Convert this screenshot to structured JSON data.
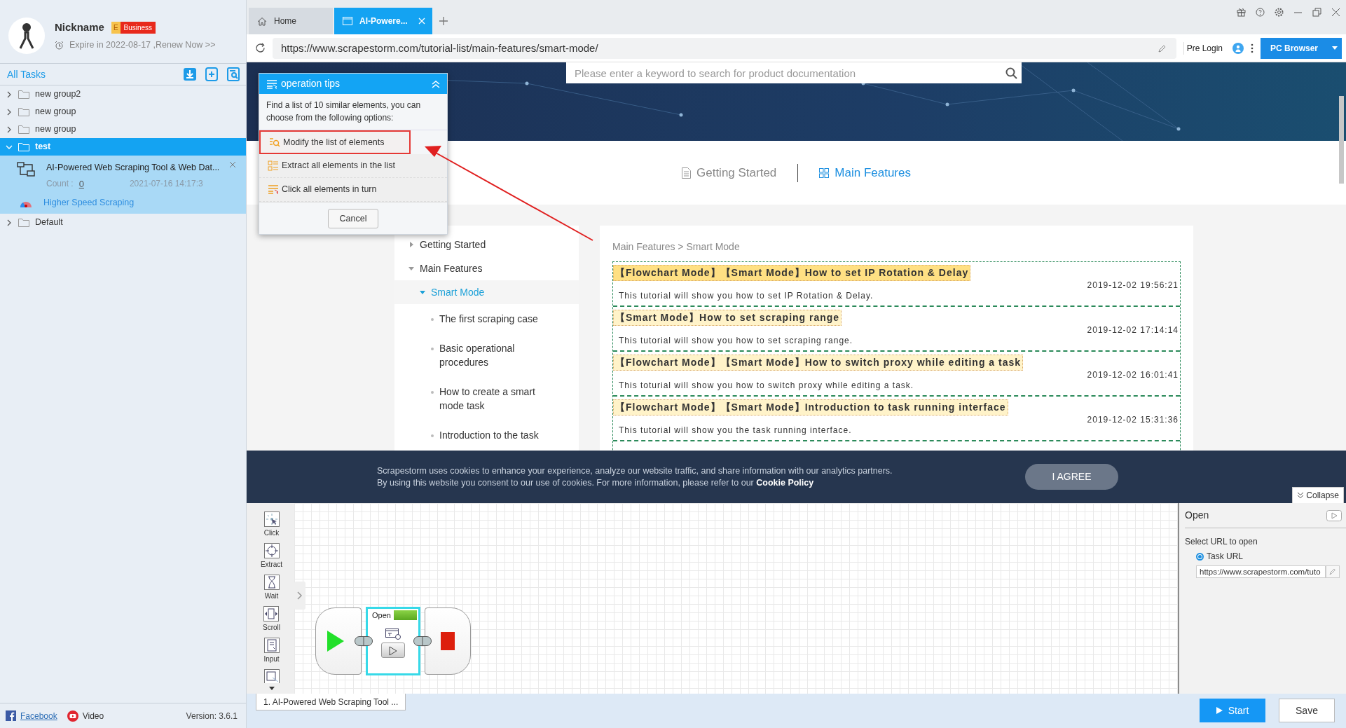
{
  "profile": {
    "nickname": "Nickname",
    "badge_letter": "E",
    "badge": "Business",
    "expire": "Expire in 2022-08-17 ,Renew Now >>"
  },
  "task_header": {
    "title": "All Tasks"
  },
  "groups": [
    {
      "name": "new group2",
      "expanded": false,
      "selected": false
    },
    {
      "name": "new group",
      "expanded": false,
      "selected": false
    },
    {
      "name": "new group",
      "expanded": false,
      "selected": false
    },
    {
      "name": "test",
      "expanded": true,
      "selected": true,
      "tasks": [
        {
          "title": "AI-Powered Web Scraping Tool & Web Dat...",
          "count_label": "Count :",
          "count": "0",
          "time": "2021-07-16 14:17:3",
          "speed": "Higher Speed Scraping"
        }
      ]
    },
    {
      "name": "Default",
      "expanded": false,
      "selected": false
    }
  ],
  "sidebar_footer": {
    "links": [
      "Facebook",
      "Video"
    ],
    "version": "Version: 3.6.1"
  },
  "browser": {
    "tabs": [
      {
        "label": "Home",
        "kind": "home",
        "selected": false,
        "closable": false
      },
      {
        "label": "AI-Powere...",
        "kind": "page",
        "selected": true,
        "closable": true
      }
    ],
    "url": "https://www.scrapestorm.com/tutorial-list/main-features/smart-mode/",
    "pre_login": "Pre Login",
    "mode": "PC Browser"
  },
  "page": {
    "search_placeholder": "Please enter a keyword to search for product documentation",
    "section_tabs": [
      {
        "label": "Getting Started",
        "kind": "doc",
        "selected": false
      },
      {
        "label": "Main Features",
        "kind": "grid",
        "selected": true
      }
    ],
    "nav": [
      {
        "label": "Getting Started",
        "expanded": false,
        "selected": false
      },
      {
        "label": "Main Features",
        "expanded": true,
        "selected": false,
        "children": [
          {
            "label": "Smart Mode",
            "expanded": true,
            "selected": true,
            "children": [
              {
                "label": "The first scraping case",
                "selected": false
              },
              {
                "label": "Basic operational procedures",
                "selected": false
              },
              {
                "label": "How to create a smart mode task",
                "selected": false
              },
              {
                "label": "Introduction to the task",
                "selected": false
              }
            ]
          }
        ]
      }
    ],
    "breadcrumb": "Main Features > Smart Mode",
    "articles": [
      {
        "title": "【Flowchart Mode】【Smart Mode】How to set IP Rotation & Delay",
        "date": "2019-12-02 19:56:21",
        "summary": "This tutorial will show you how to set IP Rotation & Delay.",
        "highlighted": true
      },
      {
        "title": "【Smart Mode】How to set scraping range",
        "date": "2019-12-02 17:14:14",
        "summary": "This tutorial will show you how to set scraping range.",
        "highlighted": false
      },
      {
        "title": "【Flowchart Mode】【Smart Mode】How to switch proxy while editing a task",
        "date": "2019-12-02 16:01:41",
        "summary": "This toturial will show you how to switch proxy while editing a task.",
        "highlighted": false
      },
      {
        "title": "【Flowchart Mode】【Smart Mode】Introduction to task running interface",
        "date": "2019-12-02 15:31:36",
        "summary": "This tutorial will show you the task running interface.",
        "highlighted": false
      }
    ]
  },
  "cookie_banner": {
    "lines": [
      "Scrapestorm uses cookies to enhance your experience, analyze our website traffic, and share information with our analytics partners.",
      "By using this website you consent to our use of cookies. For more information, please refer to our **Cookie Policy**"
    ],
    "button": "I AGREE"
  },
  "tips_popup": {
    "title": "operation tips",
    "message": "Find a list of 10 similar elements, you can choose from the following options:",
    "options": [
      {
        "label": "Modify the list of elements",
        "kind": "modify",
        "selected": true
      },
      {
        "label": "Extract all elements in the list",
        "kind": "extract",
        "selected": false
      },
      {
        "label": "Click all elements in turn",
        "kind": "click",
        "selected": false
      }
    ],
    "cancel": "Cancel"
  },
  "designer": {
    "tools": [
      {
        "label": "Click",
        "kind": "click"
      },
      {
        "label": "Extract",
        "kind": "extract"
      },
      {
        "label": "Wait",
        "kind": "wait"
      },
      {
        "label": "Scroll",
        "kind": "scroll"
      },
      {
        "label": "Input",
        "kind": "input"
      }
    ],
    "nodes": [
      {
        "kind": "start",
        "selected": false
      },
      {
        "kind": "open",
        "label": "Open",
        "selected": true
      },
      {
        "kind": "end",
        "selected": false
      }
    ],
    "collapse": "Collapse",
    "task_tab": "1. AI-Powered Web Scraping Tool ..."
  },
  "properties": {
    "title": "Open",
    "section": "Select URL to open",
    "options": [
      {
        "label": "Task URL",
        "selected": true
      }
    ],
    "url_value": "https://www.scrapestorm.com/tuto"
  },
  "actions": {
    "start": "Start",
    "save": "Save"
  }
}
